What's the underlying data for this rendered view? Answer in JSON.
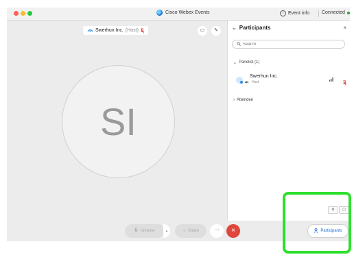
{
  "window": {
    "title": "Cisco Webex Events",
    "event_info": "Event info",
    "status": "Connected"
  },
  "stage": {
    "host_name": "Swerhun Inc.",
    "host_role": "(Host)",
    "avatar_initials": "SI"
  },
  "participants_panel": {
    "title": "Participants",
    "search_placeholder": "Search",
    "panelist_section": "Panelist (1)",
    "attendee_section": "Attendee",
    "panelists": [
      {
        "name": "Swerhun Inc.",
        "role": "Host"
      }
    ]
  },
  "controls": {
    "unmute_label": "Unmute",
    "share_label": "Share",
    "more_label": "···",
    "participants_label": "Participants"
  },
  "colors": {
    "accent": "#1a6ed8",
    "leave": "#e0473c",
    "connected": "#2ea043",
    "highlight": "#2de02d"
  }
}
